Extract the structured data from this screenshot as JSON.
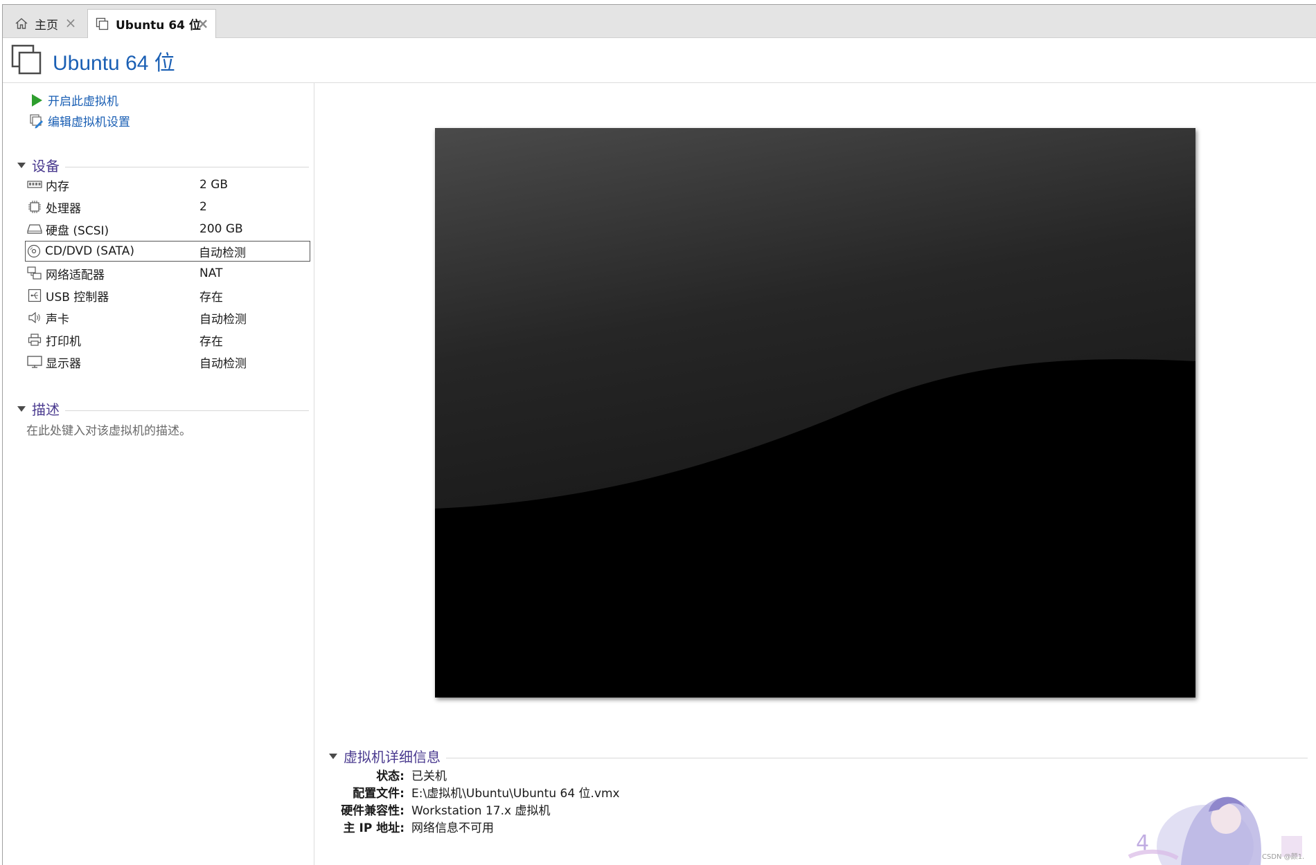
{
  "tabs": [
    {
      "label": "主页",
      "icon": "home-icon",
      "active": false
    },
    {
      "label": "Ubuntu 64 位",
      "icon": "vm-icon",
      "active": true
    }
  ],
  "header": {
    "title": "Ubuntu 64 位",
    "title_color": "#1a5fb4"
  },
  "actions": {
    "start": "开启此虚拟机",
    "edit": "编辑虚拟机设置"
  },
  "devices": {
    "title": "设备",
    "items": [
      {
        "name": "内存",
        "value": "2 GB",
        "icon": "memory-icon"
      },
      {
        "name": "处理器",
        "value": "2",
        "icon": "processor-icon"
      },
      {
        "name": "硬盘 (SCSI)",
        "value": "200 GB",
        "icon": "hard-disk-icon"
      },
      {
        "name": "CD/DVD (SATA)",
        "value": "自动检测",
        "icon": "cd-dvd-icon",
        "selected": true
      },
      {
        "name": "网络适配器",
        "value": "NAT",
        "icon": "network-adapter-icon"
      },
      {
        "name": "USB 控制器",
        "value": "存在",
        "icon": "usb-icon"
      },
      {
        "name": "声卡",
        "value": "自动检测",
        "icon": "sound-card-icon"
      },
      {
        "name": "打印机",
        "value": "存在",
        "icon": "printer-icon"
      },
      {
        "name": "显示器",
        "value": "自动检测",
        "icon": "display-icon"
      }
    ]
  },
  "description": {
    "title": "描述",
    "placeholder": "在此处键入对该虚拟机的描述。"
  },
  "details": {
    "title": "虚拟机详细信息",
    "rows": [
      {
        "key": "状态:",
        "value": "已关机"
      },
      {
        "key": "配置文件:",
        "value": "E:\\虚拟机\\Ubuntu\\Ubuntu 64 位.vmx"
      },
      {
        "key": "硬件兼容性:",
        "value": "Workstation 17.x 虚拟机"
      },
      {
        "key": "主 IP 地址:",
        "value": "网络信息不可用"
      }
    ]
  },
  "watermark": "CSDN @颜1.",
  "colors": {
    "accent": "#1a5fb4",
    "section": "#4a3a8f",
    "start_green": "#2e9e2e"
  }
}
